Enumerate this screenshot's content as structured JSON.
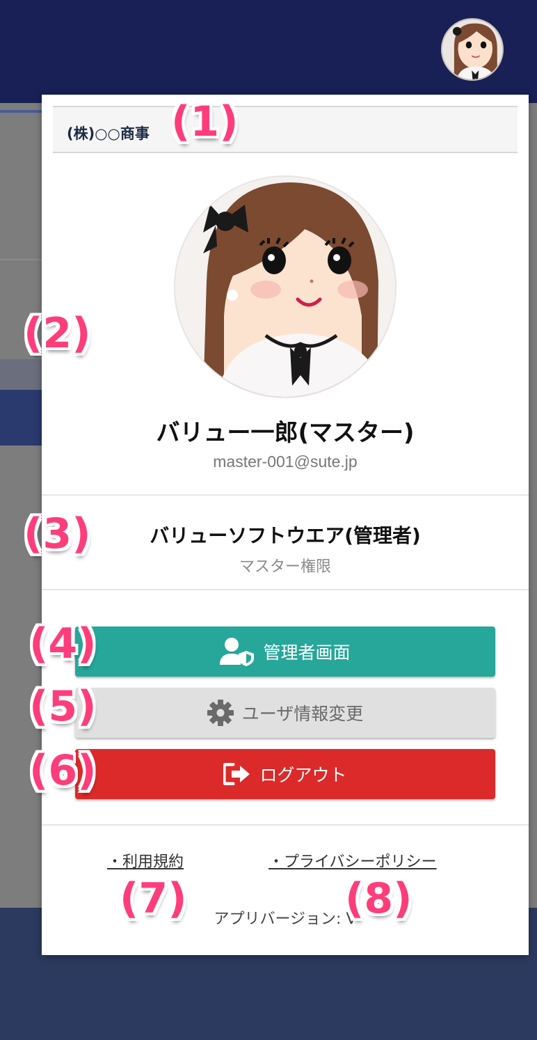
{
  "company": {
    "name": "(株)○○商事"
  },
  "user": {
    "name": "バリュー一郎(マスター)",
    "email": "master-001@sute.jp"
  },
  "organization": {
    "name": "バリューソフトウエア(管理者)",
    "role": "マスター権限"
  },
  "buttons": {
    "admin_label": "管理者画面",
    "settings_label": "ユーザ情報変更",
    "logout_label": "ログアウト"
  },
  "links": {
    "terms_label": "・利用規約",
    "privacy_label": "・プライバシーポリシー"
  },
  "footer": {
    "app_version_label": "アプリバージョン: V"
  },
  "callouts": [
    "(1)",
    "(2)",
    "(3)",
    "(4)",
    "(5)",
    "(6)",
    "(7)",
    "(8)"
  ],
  "icons": {
    "admin": "user-shield-icon",
    "settings": "gear-icon",
    "logout": "sign-out-icon",
    "avatar": "user-avatar"
  },
  "colors": {
    "header": "#182056",
    "admin_button": "#27a69a",
    "settings_button": "#e0e0e0",
    "logout_button": "#dc2a2a",
    "callout": "#ff3d7a"
  }
}
